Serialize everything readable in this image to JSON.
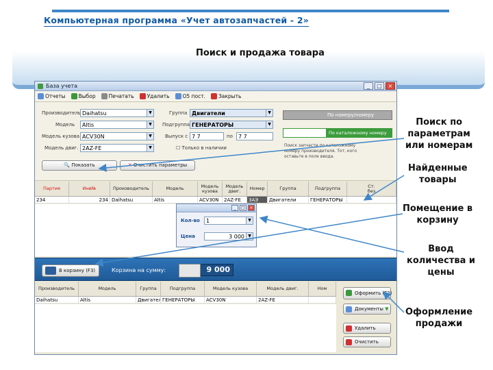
{
  "slide": {
    "title": "Компьютерная программа «Учет автозапчастей - 2»",
    "subtitle": "Поиск и продажа товара",
    "accent_color": "#3f86c8",
    "callouts": [
      "Поиск по\nпараметрам\nили номерам",
      "Найденные\nтовары",
      "Помещение в\nкорзину",
      "Ввод\nколичества и\nцены",
      "Оформление\nпродажи"
    ]
  },
  "window": {
    "title": "База учета",
    "controls": [
      "_",
      "□",
      "×"
    ],
    "toolbar": [
      {
        "label": "Отчеты",
        "icon": "report-icon",
        "color": "#5a8fd6"
      },
      {
        "label": "Выбор",
        "icon": "check-icon",
        "color": "#3a9a3a"
      },
      {
        "label": "Печатать",
        "icon": "print-icon",
        "color": "#8a8a8a"
      },
      {
        "label": "Удалить",
        "icon": "delete-icon",
        "color": "#d03030"
      },
      {
        "label": "О5 пост.",
        "icon": "post-icon",
        "color": "#5a8fd6"
      },
      {
        "label": "Закрыть",
        "icon": "close-icon",
        "color": "#d03030"
      }
    ]
  },
  "params": {
    "manufacturer": {
      "label": "Производитель",
      "value": "Daihatsu"
    },
    "model": {
      "label": "Модель",
      "value": "Altis"
    },
    "body_model": {
      "label": "Модель кузова",
      "value": "ACV30N"
    },
    "engine_model": {
      "label": "Модель двиг.",
      "value": "2AZ-FE"
    },
    "group": {
      "label": "Группа",
      "value": "Двигатели"
    },
    "subgroup": {
      "label": "Подгруппа",
      "value": "ГЕНЕРАТОРЫ"
    },
    "year": {
      "label": "Выпуск с",
      "from": "7 7 ",
      "to_label": "по",
      "to": "7 7"
    },
    "checkbox_label": "Только в наличии",
    "show_button": "Показать",
    "clear_button": "Очистить параметры",
    "search_by_number": "По номеру/номеру",
    "search_by_catalog": "По каталожному номеру",
    "note": "Поиск запчасти по каталожному\nномеру производителя. Тот, кого\nоставьте в поле ввода."
  },
  "results": {
    "columns": [
      "Партия",
      "Инв№",
      "Производитель",
      "Модель",
      "Модель кузова",
      "Модель двиг.",
      "Номер ",
      "Группа",
      "Подгруппа",
      "Ст.\nбез"
    ],
    "rows": [
      [
        "234",
        "234",
        "Daihatsu",
        "Altis",
        "ACV30N",
        "2AZ-FE",
        "ЗАЭ",
        "Двигатели",
        "ГЕНЕРАТОРЫ",
        ""
      ]
    ]
  },
  "popup": {
    "qty_label": "Кол-во",
    "qty_value": "1",
    "price_label": "Цена",
    "price_value": "3 000"
  },
  "cart": {
    "button": "В корзину (F3)",
    "sum_label": "Корзина на сумму:",
    "sum_value": "9 000",
    "columns": [
      "Производитель",
      "Модель",
      "Группа",
      "Подгруппа",
      "Модель кузова",
      "Модель двиг.",
      "Ном"
    ],
    "rows": [
      [
        "Daihatsu",
        "Altis",
        "Двигатели",
        "ГЕНЕРАТОРЫ",
        "ACV30N",
        "2AZ-FE",
        ""
      ]
    ]
  },
  "actions": {
    "checkout": "Оформить (F2)",
    "documents": "Документы",
    "delete": "Удалить",
    "clear": "Очистить"
  }
}
